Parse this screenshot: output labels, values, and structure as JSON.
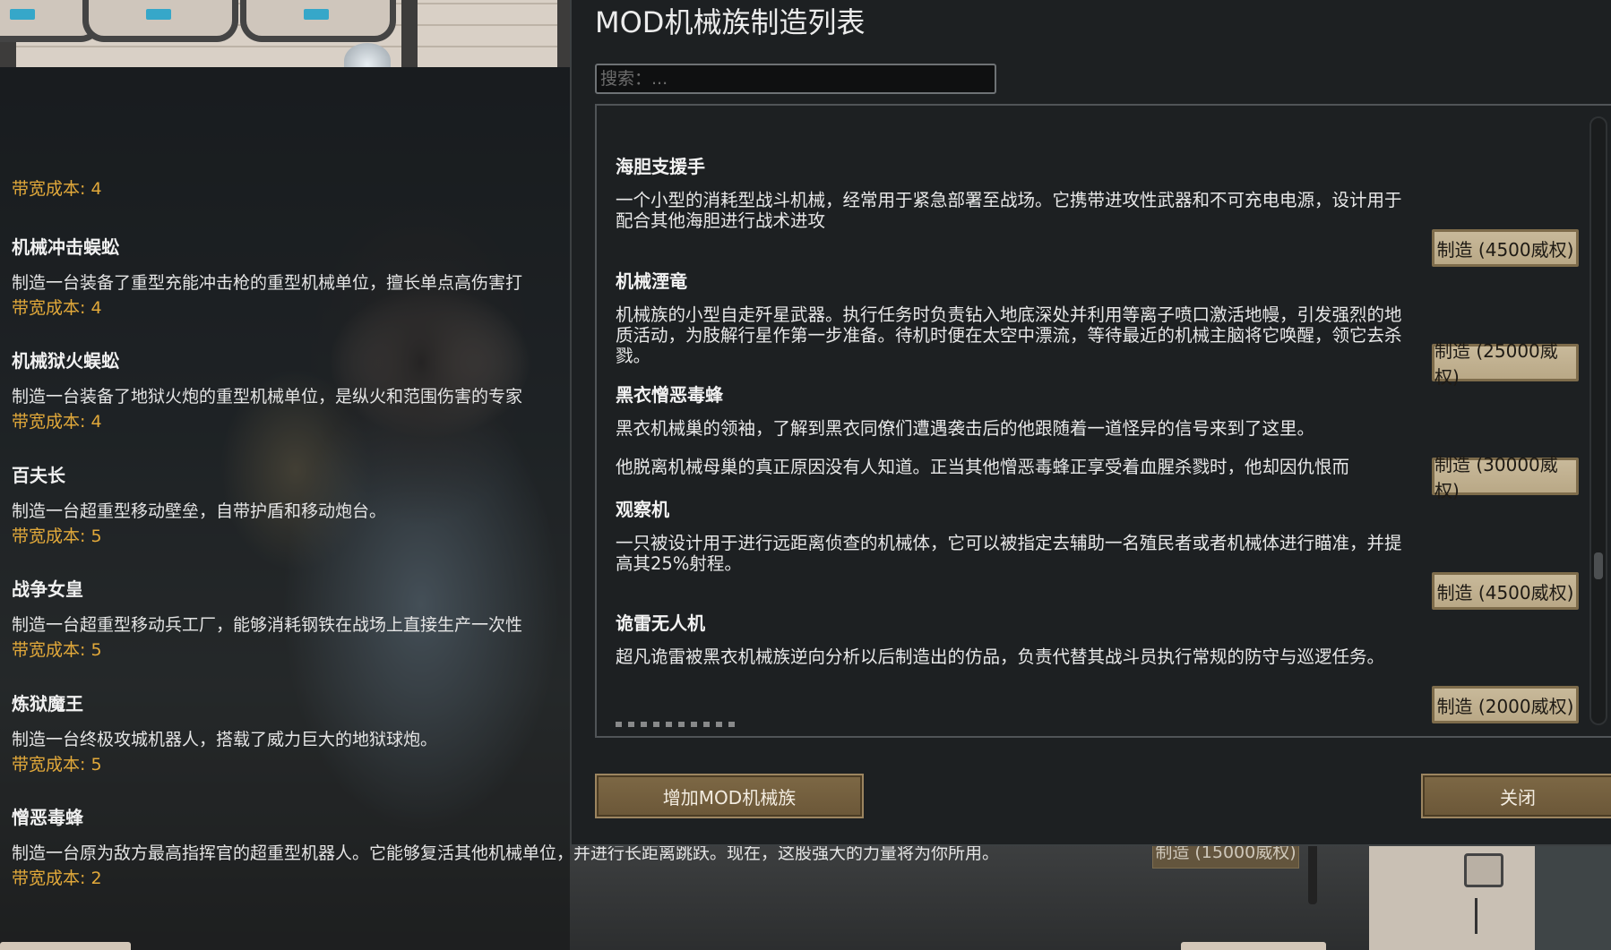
{
  "background_list": {
    "items": [
      {
        "title": "",
        "desc": "",
        "cost": "带宽成本: 4"
      },
      {
        "title": "机械冲击蜈蚣",
        "desc": "制造一台装备了重型充能冲击枪的重型机械单位，擅长单点高伤害打",
        "cost": "带宽成本: 4"
      },
      {
        "title": "机械狱火蜈蚣",
        "desc": "制造一台装备了地狱火炮的重型机械单位，是纵火和范围伤害的专家",
        "cost": "带宽成本: 4"
      },
      {
        "title": "百夫长",
        "desc": "制造一台超重型移动壁垒，自带护盾和移动炮台。",
        "cost": "带宽成本: 5"
      },
      {
        "title": "战争女皇",
        "desc": "制造一台超重型移动兵工厂，能够消耗钢铁在战场上直接生产一次性",
        "cost": "带宽成本: 5"
      },
      {
        "title": "炼狱魔王",
        "desc": "制造一台终极攻城机器人，搭载了威力巨大的地狱球炮。",
        "cost": "带宽成本: 5"
      },
      {
        "title": "憎恶毒蜂",
        "desc": "制造一台原为敌方最高指挥官的超重型机器人。它能够复活其他机械单位，并进行长距离跳跃。现在，这股强大的力量将为你所用。",
        "cost": "带宽成本: 2"
      }
    ],
    "build_button": "制造 (15000威权)"
  },
  "dialog": {
    "title": "MOD机械族制造列表",
    "search_placeholder": "搜索：...",
    "entries": [
      {
        "title": "海胆支援手",
        "desc": "一个小型的消耗型战斗机械，经常用于紧急部署至战场。它携带进攻性武器和不可充电电源，设计用于配合其他海胆进行战术进攻",
        "button": "制造 (4500威权)"
      },
      {
        "title": "机械湮竜",
        "desc": "机械族的小型自走歼星武器。执行任务时负责钻入地底深处并利用等离子喷口激活地幔，引发强烈的地质活动，为肢解行星作第一步准备。待机时便在太空中漂流，等待最近的机械主脑将它唤醒，领它去杀戮。",
        "button": "制造 (25000威权)"
      },
      {
        "title": "黑衣憎恶毒蜂",
        "desc": "黑衣机械巢的领袖，了解到黑衣同僚们遭遇袭击后的他跟随着一道怪异的信号来到了这里。",
        "desc2": "他脱离机械母巢的真正原因没有人知道。正当其他憎恶毒蜂正享受着血腥杀戮时，他却因仇恨而",
        "button": "制造 (30000威权)"
      },
      {
        "title": "观察机",
        "desc": "一只被设计用于进行远距离侦查的机械体，它可以被指定去辅助一名殖民者或者机械体进行瞄准，并提高其25%射程。",
        "button": "制造 (4500威权)"
      },
      {
        "title": "诡雷无人机",
        "desc": "超凡诡雷被黑衣机械族逆向分析以后制造出的仿品，负责代替其战斗员执行常规的防守与巡逻任务。",
        "button": "制造 (2000威权)"
      }
    ],
    "add_button": "增加MOD机械族",
    "close_button": "关闭"
  }
}
